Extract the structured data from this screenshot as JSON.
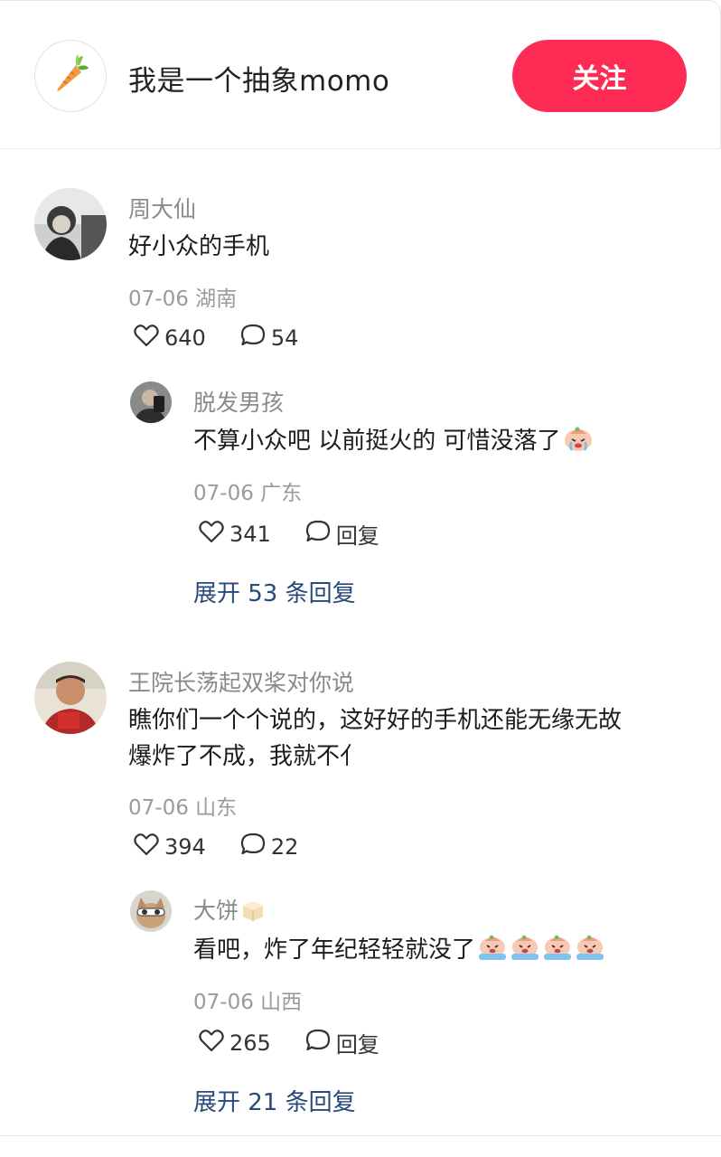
{
  "header": {
    "avatar_icon": "carrot-icon",
    "name": "我是一个抽象momo",
    "follow_label": "关注",
    "follow_color": "#fe2c55"
  },
  "comments": [
    {
      "username": "周大仙",
      "text": "好小众的手机",
      "date": "07-06",
      "location": "湖南",
      "likes": "640",
      "replies_count": "54",
      "reply": {
        "username": "脱发男孩",
        "text": "不算小众吧 以前挺火的 可惜没落了",
        "emoji": "crying-face-icon",
        "date": "07-06",
        "location": "广东",
        "likes": "341",
        "reply_label": "回复"
      },
      "expand_label": "展开 53 条回复"
    },
    {
      "username": "王院长荡起双桨对你说",
      "text_line1": "瞧你们一个个说的，这好好的手机还能无缘无故",
      "text_line2": "爆炸了不成，我就不亻",
      "date": "07-06",
      "location": "山东",
      "likes": "394",
      "replies_count": "22",
      "reply": {
        "username": "大饼",
        "name_emoji": "box-icon",
        "text": "看吧，炸了年纪轻轻就没了",
        "emoji": "crying-face-icon",
        "date": "07-06",
        "location": "山西",
        "likes": "265",
        "reply_label": "回复"
      },
      "expand_label": "展开 21 条回复"
    }
  ],
  "colors": {
    "link": "#284a7a",
    "meta": "#9a9a9a",
    "username": "#8a8a8a"
  }
}
